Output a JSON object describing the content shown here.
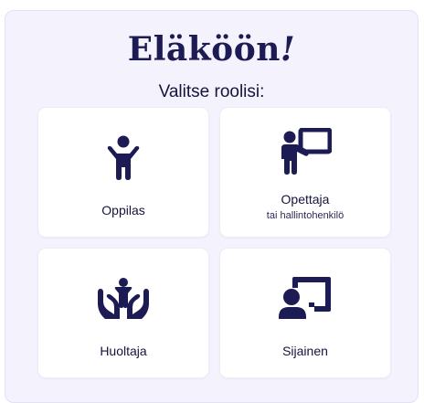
{
  "logo": {
    "text": "Eläköön",
    "exclamation": "!"
  },
  "subtitle": "Valitse roolisi:",
  "roles": [
    {
      "label": "Oppilas",
      "icon": "child-arms-raised-icon"
    },
    {
      "label": "Opettaja",
      "sublabel": "tai hallintohenkilö",
      "icon": "teacher-whiteboard-icon"
    },
    {
      "label": "Huoltaja",
      "icon": "hands-holding-child-icon"
    },
    {
      "label": "Sijainen",
      "icon": "person-at-board-icon"
    }
  ],
  "colors": {
    "accent": "#1c1b53",
    "panel_background": "#f4f3fd",
    "card_background": "#ffffff"
  }
}
